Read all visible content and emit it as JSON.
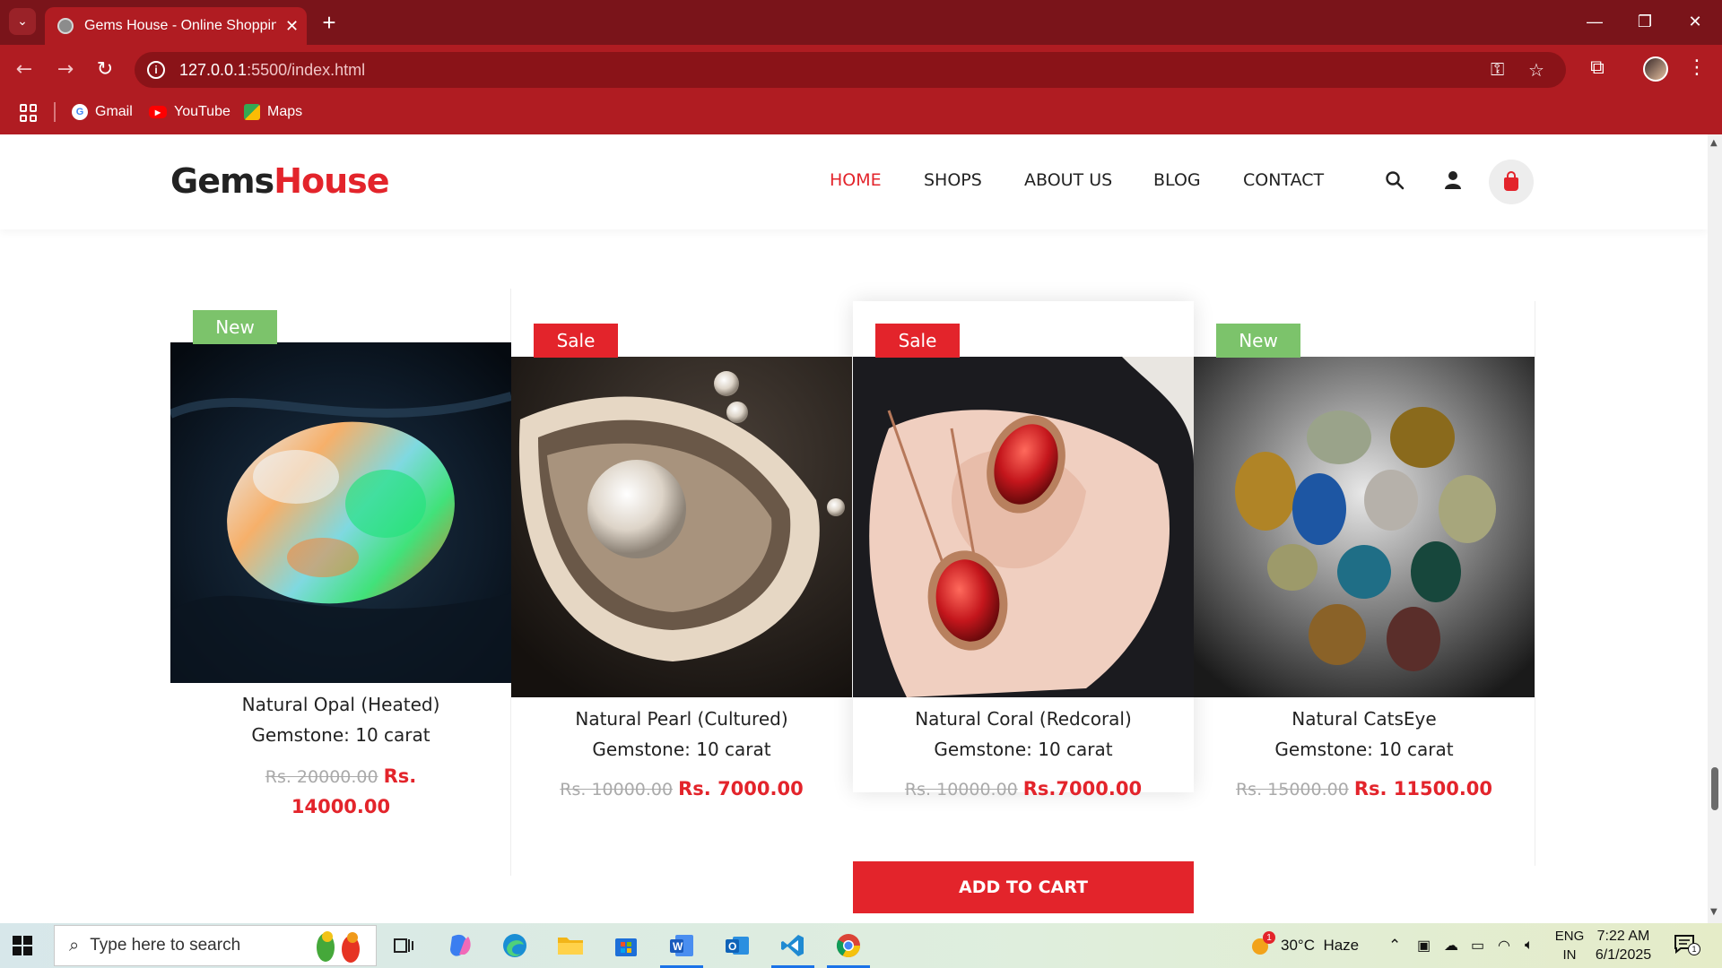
{
  "browser": {
    "tab_title": "Gems House - Online Shopping",
    "url_host": "127.0.0.1",
    "url_path": ":5500/index.html",
    "bookmarks": [
      {
        "label": "Gmail",
        "icon": "google-icon"
      },
      {
        "label": "YouTube",
        "icon": "youtube-icon"
      },
      {
        "label": "Maps",
        "icon": "maps-icon"
      }
    ]
  },
  "site": {
    "logo_part1": "Gems",
    "logo_part2": "House",
    "brand_color": "#e3242b",
    "nav": [
      "HOME",
      "SHOPS",
      "ABOUT US",
      "BLOG",
      "CONTACT"
    ],
    "active_nav": "HOME"
  },
  "products": [
    {
      "badge": "New",
      "badge_color": "#7cc36b",
      "name": "Natural Opal (Heated)",
      "spec": "Gemstone: 10 carat",
      "old_price": "Rs. 20000.00",
      "price": "Rs. 14000.00",
      "image": "opal"
    },
    {
      "badge": "Sale",
      "badge_color": "#e3242b",
      "name": "Natural Pearl (Cultured)",
      "spec": "Gemstone: 10 carat",
      "old_price": "Rs. 10000.00",
      "price": "Rs. 7000.00",
      "image": "pearl"
    },
    {
      "badge": "Sale",
      "badge_color": "#e3242b",
      "name": "Natural Coral (Redcoral)",
      "spec": "Gemstone: 10 carat",
      "old_price": "Rs. 10000.00",
      "price": "Rs.7000.00",
      "image": "coral"
    },
    {
      "badge": "New",
      "badge_color": "#7cc36b",
      "name": "Natural CatsEye",
      "spec": "Gemstone: 10 carat",
      "old_price": "Rs. 15000.00",
      "price": "Rs. 11500.00",
      "image": "catseye"
    }
  ],
  "add_to_cart": "ADD TO CART",
  "taskbar": {
    "search_placeholder": "Type here to search",
    "weather_temp": "30°C",
    "weather_desc": "Haze",
    "weather_alert": "1",
    "lang_line1": "ENG",
    "lang_line2": "IN",
    "time": "7:22 AM",
    "date": "6/1/2025",
    "notification_count": "1"
  }
}
